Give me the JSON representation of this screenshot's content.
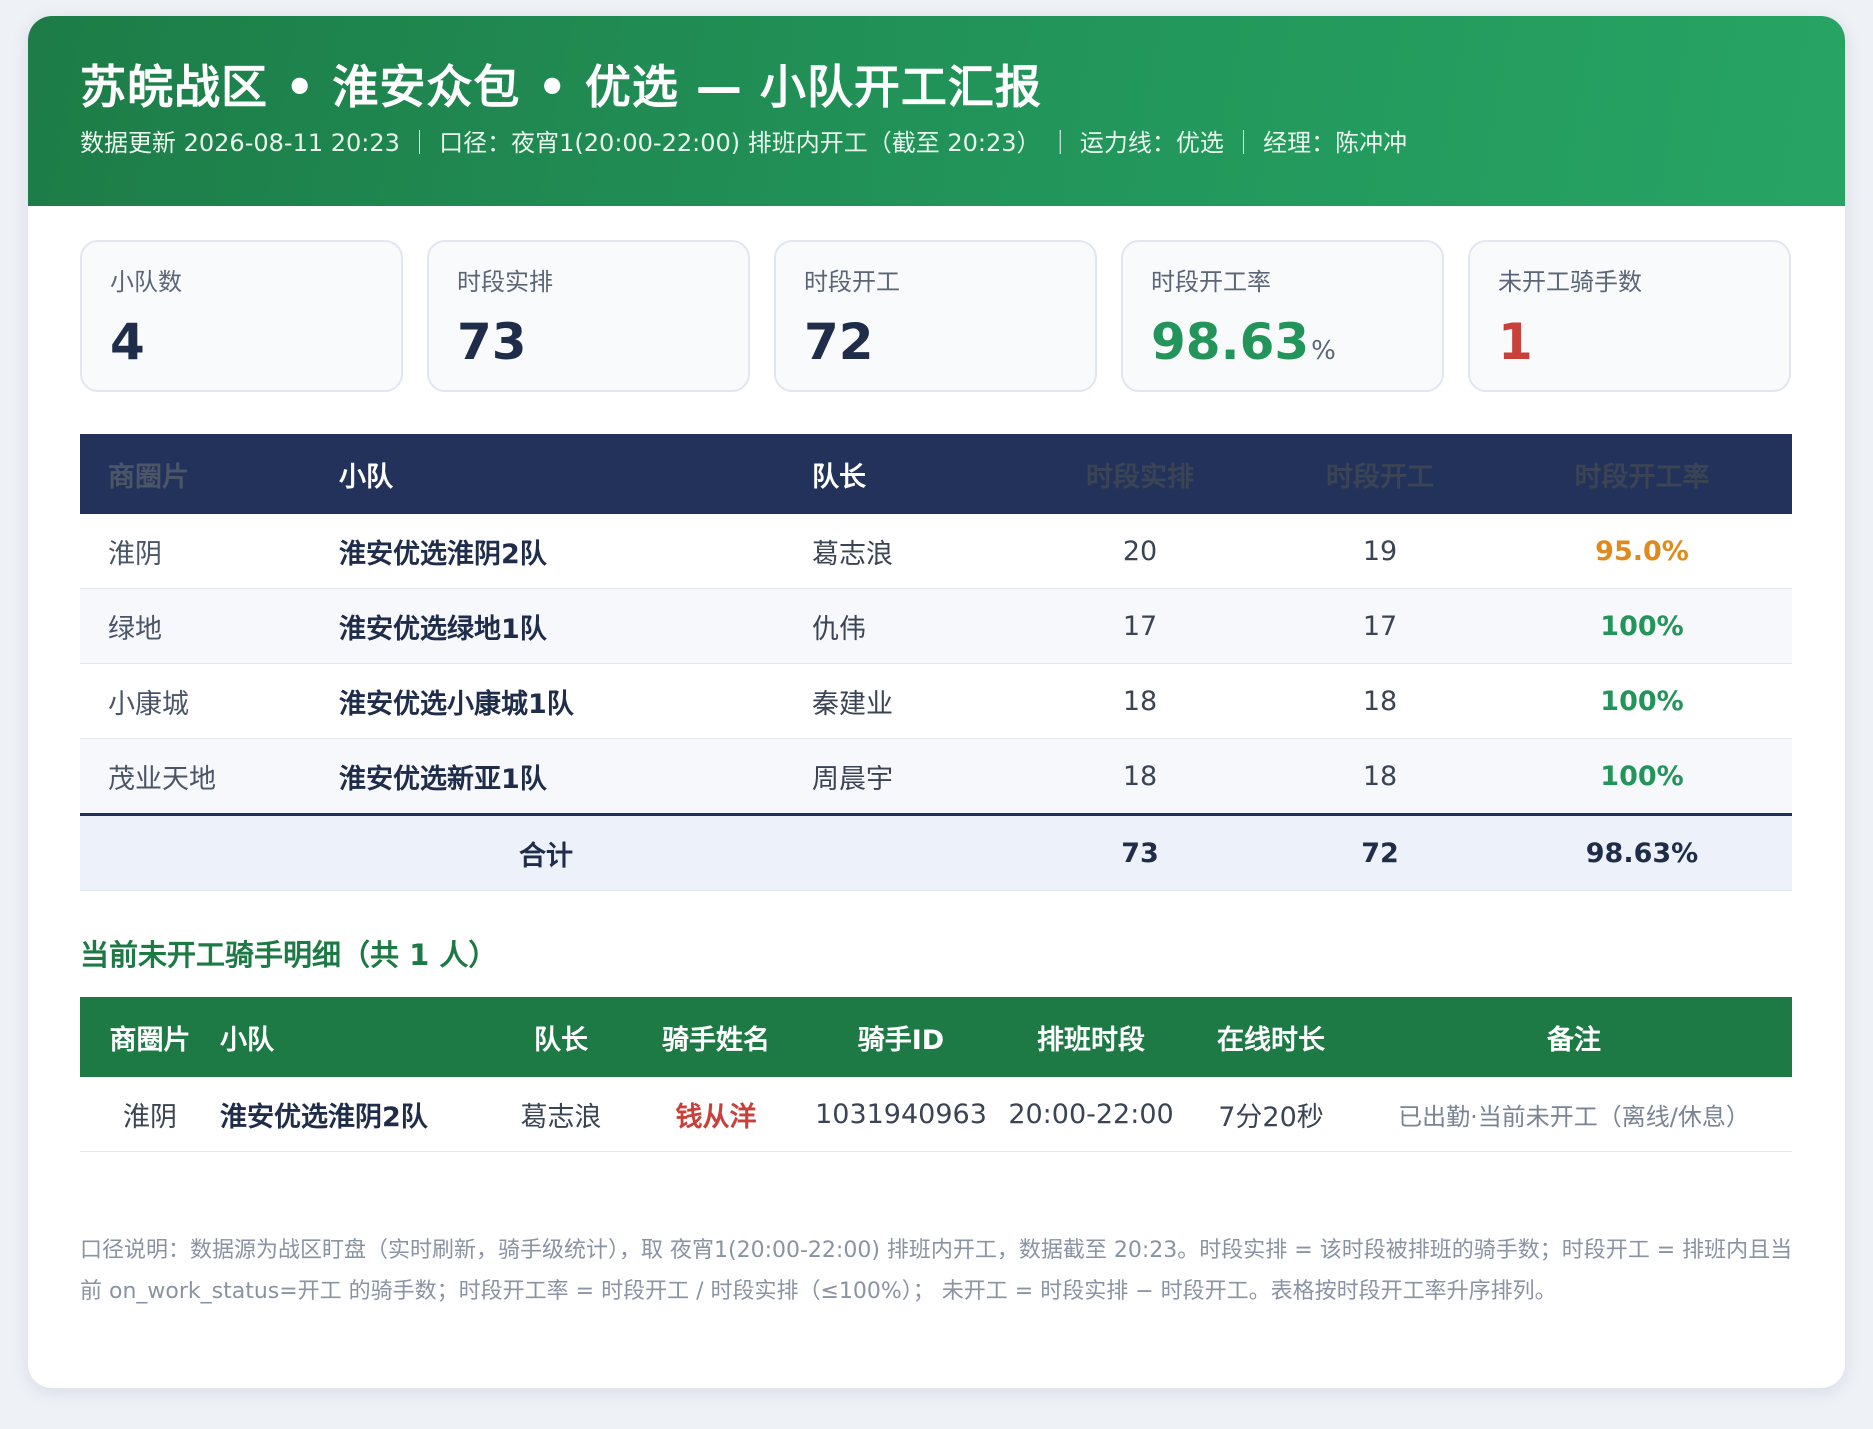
{
  "header": {
    "title": "苏皖战区 • 淮安众包 • 优选 — 小队开工汇报",
    "subtitle": "数据更新 2026-08-11 20:23 ｜ 口径：夜宵1(20:00-22:00) 排班内开工（截至 20:23） ｜ 运力线：优选 ｜ 经理：陈冲冲"
  },
  "kpis": [
    {
      "label": "小队数",
      "value": "4",
      "unit": ""
    },
    {
      "label": "时段实排",
      "value": "73",
      "unit": ""
    },
    {
      "label": "时段开工",
      "value": "72",
      "unit": ""
    },
    {
      "label": "时段开工率",
      "value": "98.63",
      "unit": "%"
    },
    {
      "label": "未开工骑手数",
      "value": "1",
      "unit": ""
    }
  ],
  "team_table": {
    "headers": [
      "商圈片",
      "小队",
      "队长",
      "时段实排",
      "时段开工",
      "时段开工率"
    ],
    "rows": [
      {
        "area": "淮阴",
        "team": "淮安优选淮阴2队",
        "leader": "葛志浪",
        "scheduled": "20",
        "working": "19",
        "rate": "95.0%"
      },
      {
        "area": "绿地",
        "team": "淮安优选绿地1队",
        "leader": "仇伟",
        "scheduled": "17",
        "working": "17",
        "rate": "100%"
      },
      {
        "area": "小康城",
        "team": "淮安优选小康城1队",
        "leader": "秦建业",
        "scheduled": "18",
        "working": "18",
        "rate": "100%"
      },
      {
        "area": "茂业天地",
        "team": "淮安优选新亚1队",
        "leader": "周晨宇",
        "scheduled": "18",
        "working": "18",
        "rate": "100%"
      }
    ],
    "total": {
      "label": "合计",
      "scheduled": "73",
      "working": "72",
      "rate": "98.63%"
    }
  },
  "rider_section": {
    "title": "当前未开工骑手明细（共 1 人）",
    "headers": [
      "商圈片",
      "小队",
      "队长",
      "骑手姓名",
      "骑手ID",
      "排班时段",
      "在线时长",
      "备注"
    ],
    "rows": [
      {
        "area": "淮阴",
        "team": "淮安优选淮阴2队",
        "leader": "葛志浪",
        "name": "钱从洋",
        "id": "1031940963",
        "shift": "20:00-22:00",
        "online": "7分20秒",
        "remark": "已出勤·当前未开工（离线/休息）"
      }
    ]
  },
  "note": "口径说明：数据源为战区盯盘（实时刷新，骑手级统计），取 夜宵1(20:00-22:00) 排班内开工，数据截至 20:23。时段实排 = 该时段被排班的骑手数；时段开工 = 排班内且当前 on_work_status=开工 的骑手数；时段开工率 = 时段开工 / 时段实排（≤100%）； 未开工 = 时段实排 − 时段开工。表格按时段开工率升序排列。",
  "colors": {
    "header_green": "#23945a",
    "table_navy": "#23325a",
    "rate_warn": "#e08a1e",
    "rate_ok": "#23945a",
    "alert_red": "#c9403a"
  }
}
